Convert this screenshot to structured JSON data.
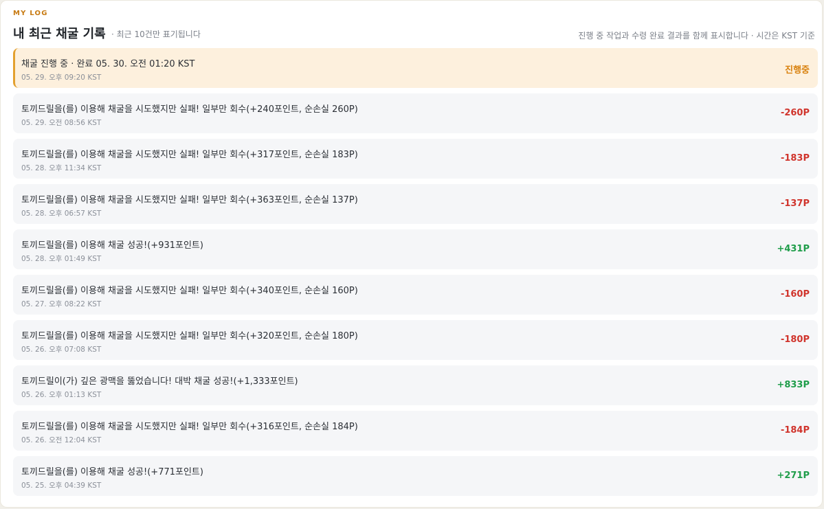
{
  "header": {
    "eyebrow": "MY LOG",
    "title": "내 최근 채굴 기록",
    "subtitle": "· 최근 10건만 표기됩니다",
    "note": "진행 중 작업과 수령 완료 결과를 함께 표시합니다 · 시간은 KST 기준"
  },
  "colors": {
    "accent": "#c77a12",
    "pending_bg": "#fdf0dd",
    "pending_border": "#e3a02e",
    "negative": "#d0342c",
    "positive": "#1f9d4a"
  },
  "records": [
    {
      "text": "채굴 진행 중 · 완료 05. 30. 오전 01:20 KST",
      "time": "05. 29. 오후 09:20 KST",
      "amount": "진행중",
      "status": "pending"
    },
    {
      "text": "토끼드릴을(를) 이용해 채굴을 시도했지만 실패! 일부만 회수(+240포인트, 순손실 260P)",
      "time": "05. 29. 오전 08:56 KST",
      "amount": "-260P",
      "status": "neg"
    },
    {
      "text": "토끼드릴을(를) 이용해 채굴을 시도했지만 실패! 일부만 회수(+317포인트, 순손실 183P)",
      "time": "05. 28. 오후 11:34 KST",
      "amount": "-183P",
      "status": "neg"
    },
    {
      "text": "토끼드릴을(를) 이용해 채굴을 시도했지만 실패! 일부만 회수(+363포인트, 순손실 137P)",
      "time": "05. 28. 오후 06:57 KST",
      "amount": "-137P",
      "status": "neg"
    },
    {
      "text": "토끼드릴을(를) 이용해 채굴 성공!(+931포인트)",
      "time": "05. 28. 오후 01:49 KST",
      "amount": "+431P",
      "status": "pos"
    },
    {
      "text": "토끼드릴을(를) 이용해 채굴을 시도했지만 실패! 일부만 회수(+340포인트, 순손실 160P)",
      "time": "05. 27. 오후 08:22 KST",
      "amount": "-160P",
      "status": "neg"
    },
    {
      "text": "토끼드릴을(를) 이용해 채굴을 시도했지만 실패! 일부만 회수(+320포인트, 순손실 180P)",
      "time": "05. 26. 오후 07:08 KST",
      "amount": "-180P",
      "status": "neg"
    },
    {
      "text": "토끼드릴이(가) 깊은 광맥을 뚫었습니다! 대박 채굴 성공!(+1,333포인트)",
      "time": "05. 26. 오후 01:13 KST",
      "amount": "+833P",
      "status": "pos"
    },
    {
      "text": "토끼드릴을(를) 이용해 채굴을 시도했지만 실패! 일부만 회수(+316포인트, 순손실 184P)",
      "time": "05. 26. 오전 12:04 KST",
      "amount": "-184P",
      "status": "neg"
    },
    {
      "text": "토끼드릴을(를) 이용해 채굴 성공!(+771포인트)",
      "time": "05. 25. 오후 04:39 KST",
      "amount": "+271P",
      "status": "pos"
    }
  ]
}
